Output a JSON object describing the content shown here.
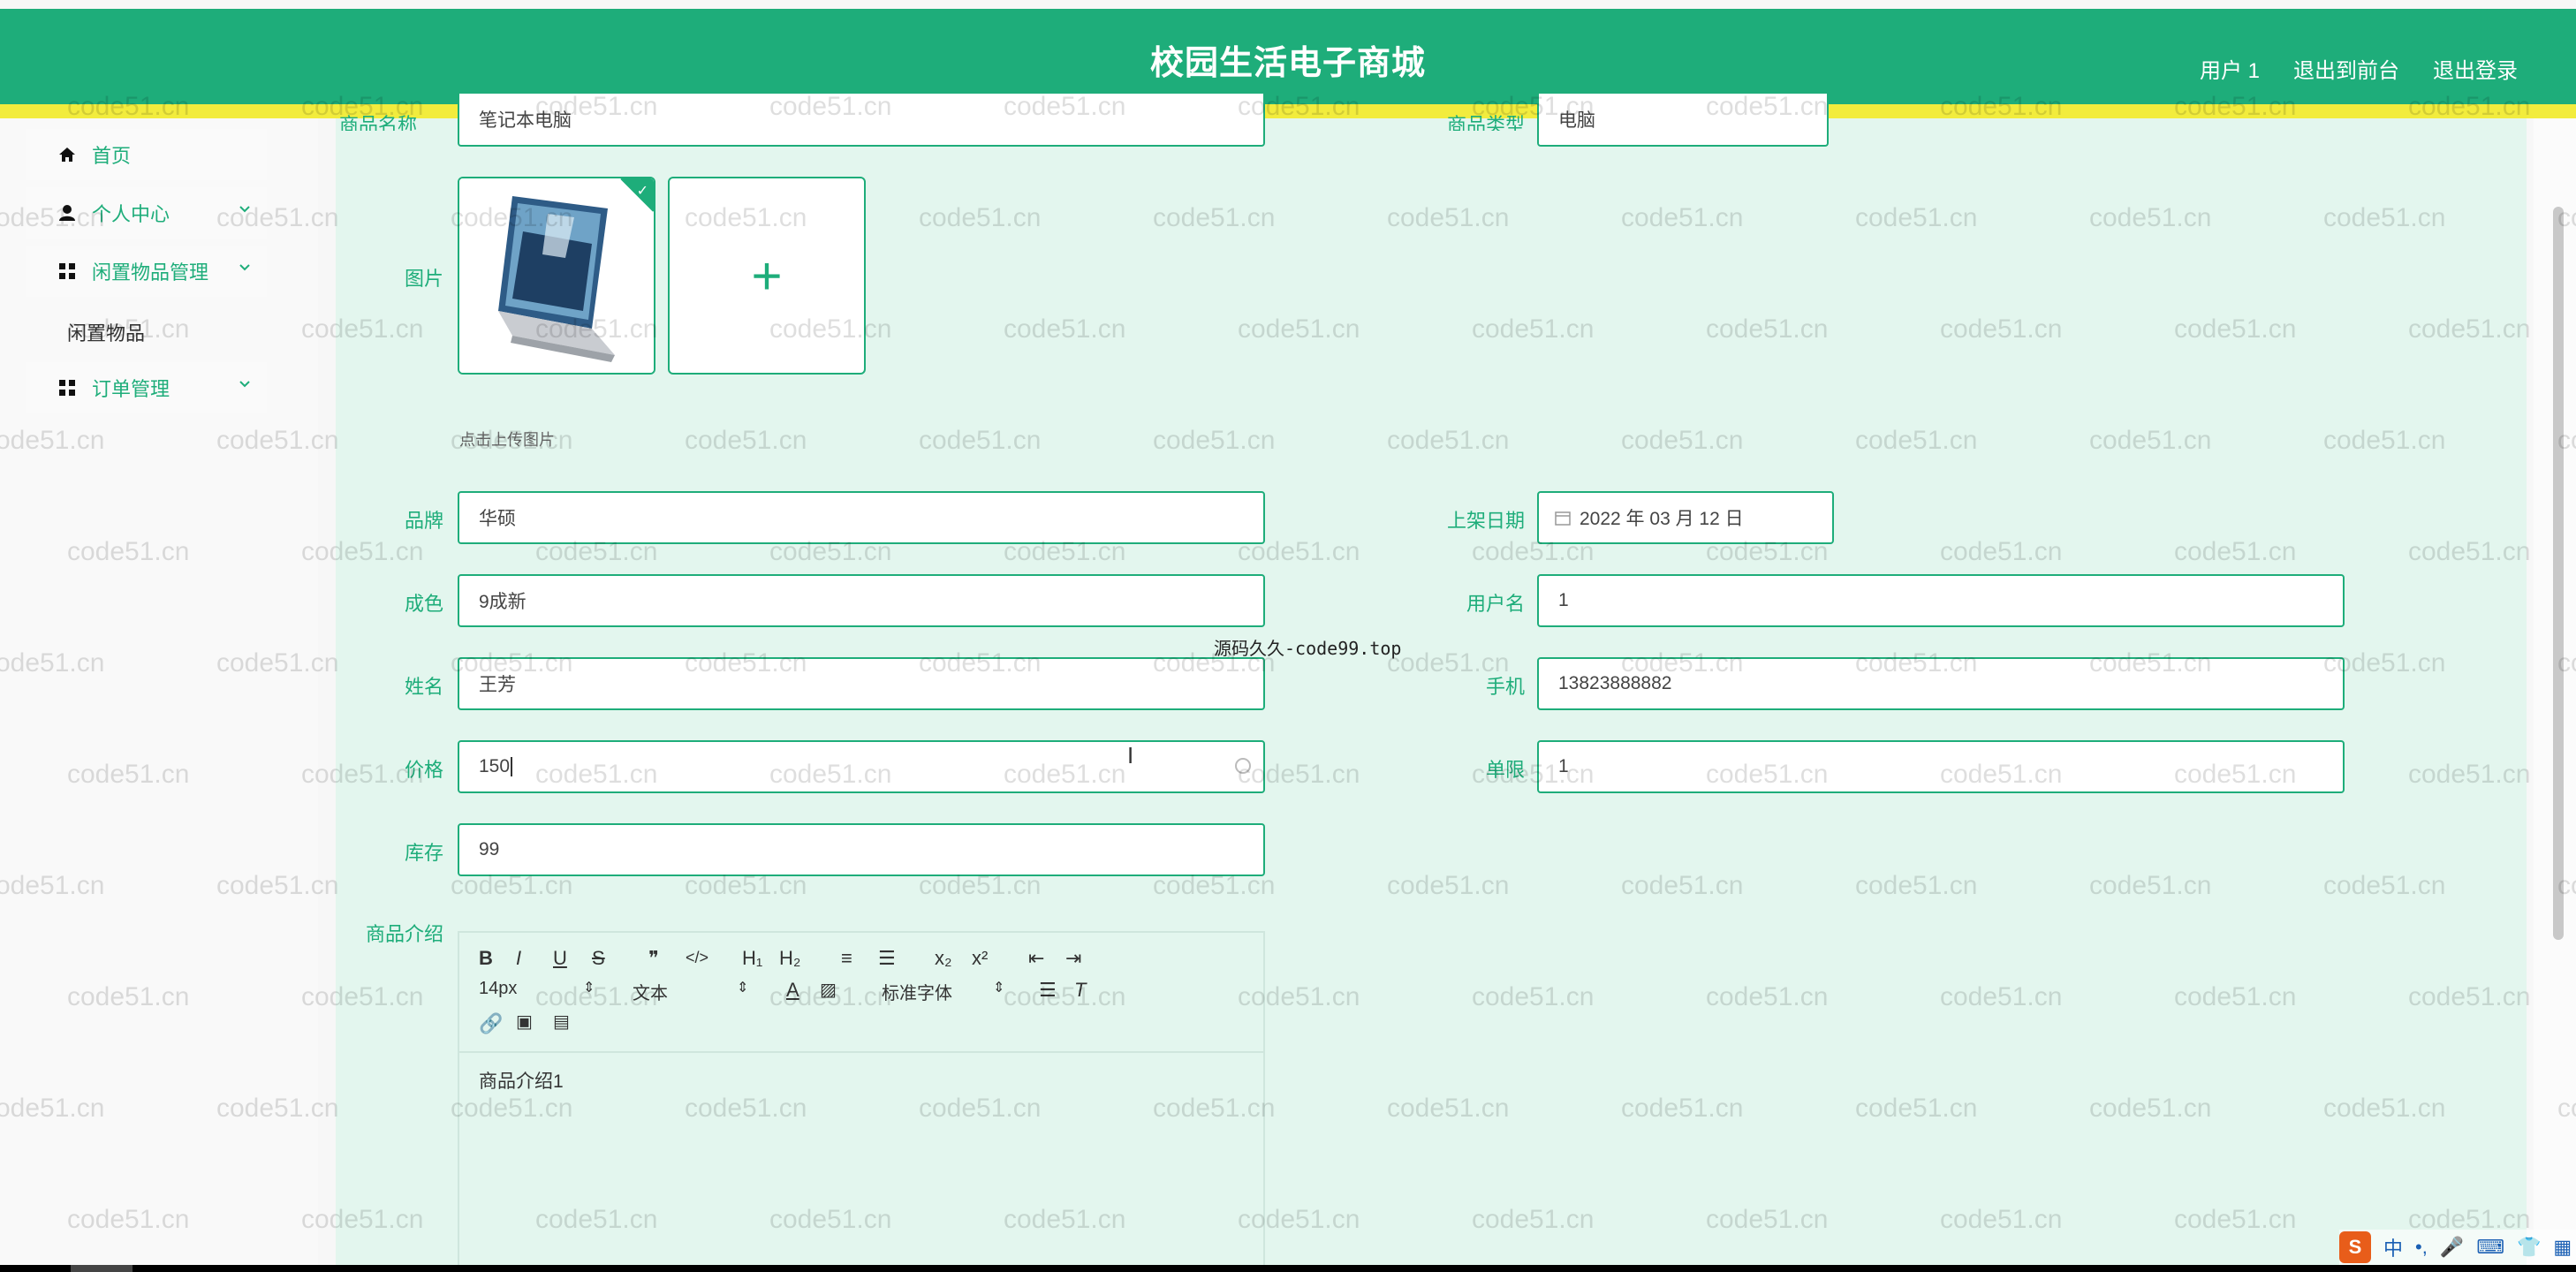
{
  "header": {
    "title": "校园生活电子商城",
    "nav": [
      "用户 1",
      "退出到前台",
      "退出登录"
    ]
  },
  "sidebar": {
    "items": [
      {
        "label": "首页",
        "icon": "home-icon"
      },
      {
        "label": "个人中心",
        "icon": "user-icon"
      },
      {
        "label": "闲置物品管理",
        "icon": "grid-icon"
      },
      {
        "label": "订单管理",
        "icon": "grid-icon"
      }
    ],
    "submenu": [
      "闲置物品"
    ]
  },
  "form": {
    "product_name": {
      "label": "商品名称",
      "value": "笔记本电脑"
    },
    "product_type": {
      "label": "商品类型",
      "value": "电脑"
    },
    "image": {
      "label": "图片",
      "upload_tip": "点击上传图片"
    },
    "brand": {
      "label": "品牌",
      "value": "华硕"
    },
    "listing_date": {
      "label": "上架日期",
      "value": "2022 年 03 月 12 日"
    },
    "condition": {
      "label": "成色",
      "value": "9成新"
    },
    "username": {
      "label": "用户名",
      "value": "1"
    },
    "name": {
      "label": "姓名",
      "value": "王芳"
    },
    "phone": {
      "label": "手机",
      "value": "13823888882"
    },
    "price": {
      "label": "价格",
      "value": "150"
    },
    "limit": {
      "label": "单限",
      "value": "1"
    },
    "stock": {
      "label": "库存",
      "value": "99"
    },
    "intro": {
      "label": "商品介绍",
      "value": "商品介绍1"
    }
  },
  "editor": {
    "font_size": "14px",
    "paragraph": "文本",
    "font_family": "标准字体",
    "buttons_row1": [
      "B",
      "I",
      "U",
      "S",
      "❞",
      "</>",
      "H₁",
      "H₂",
      "≡",
      "☰",
      "x₂",
      "x²",
      "⇤",
      "⇥"
    ]
  },
  "watermark": "code51.cn",
  "center_note": "源码久久-code99.top",
  "ime": {
    "logo": "S",
    "lang": "中"
  }
}
